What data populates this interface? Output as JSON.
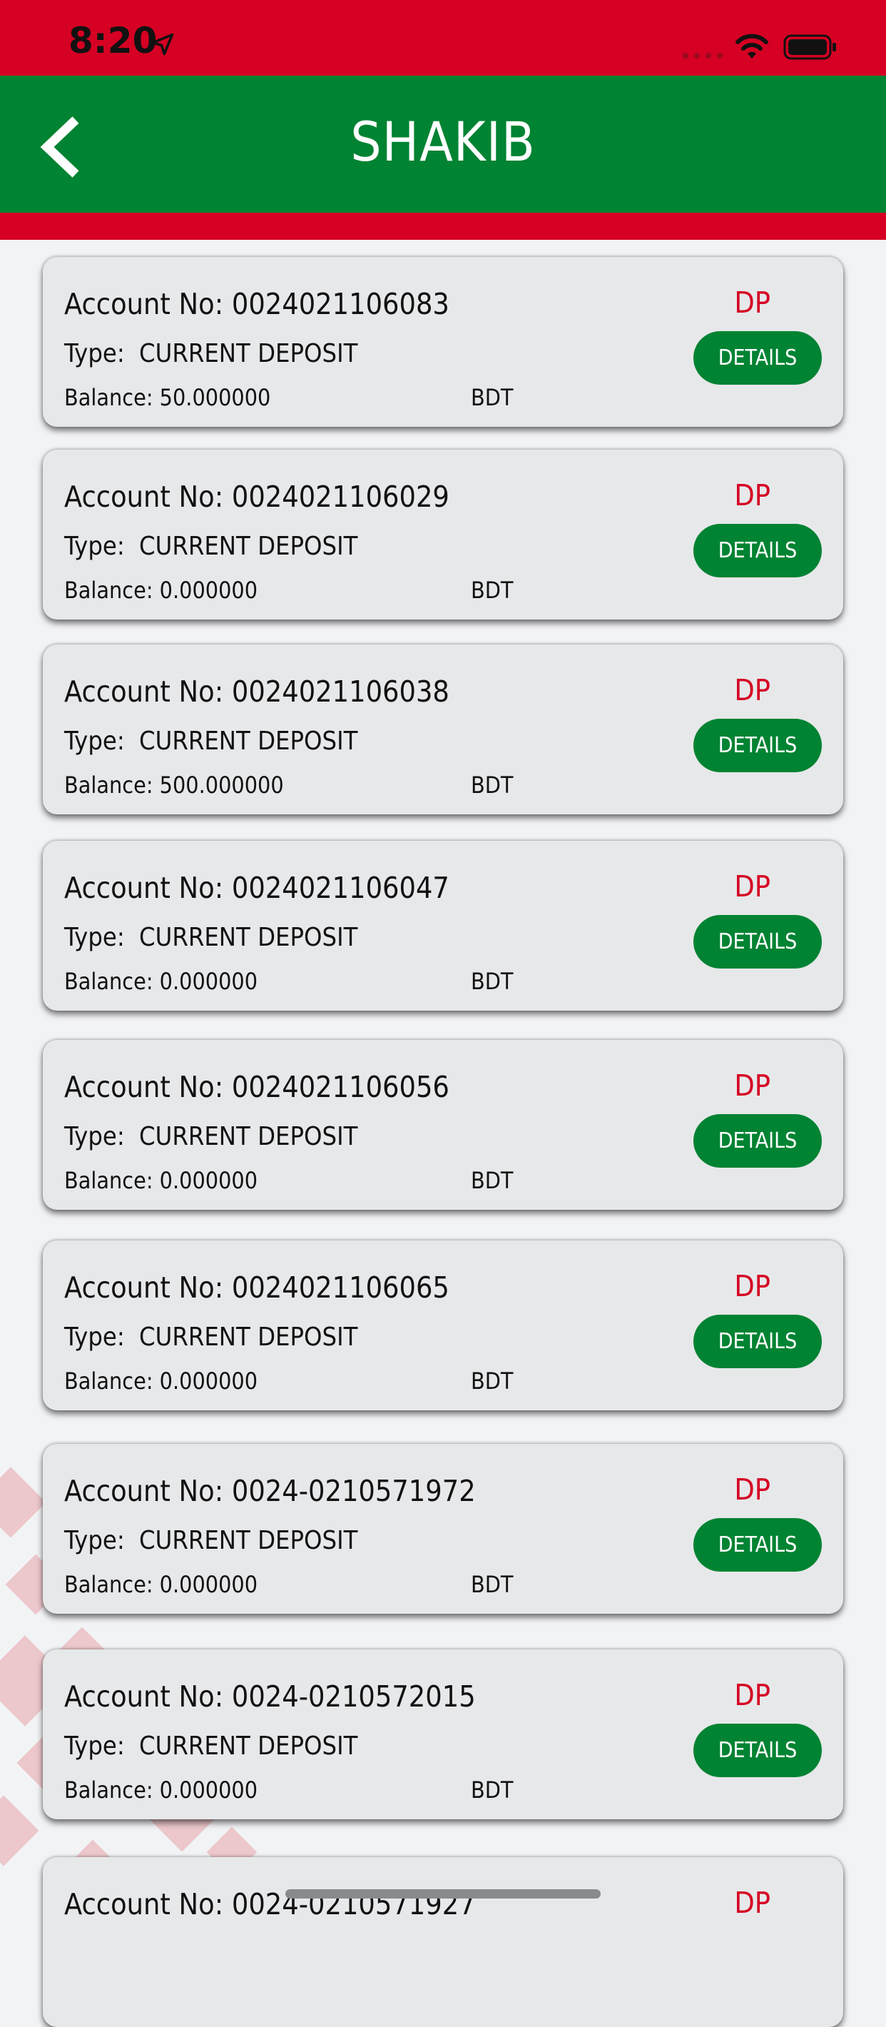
{
  "status_bar": {
    "time": "8:20"
  },
  "header": {
    "title": "SHAKIB"
  },
  "labels": {
    "account_prefix": "Account No: ",
    "type_prefix": "Type:",
    "balance_prefix": "Balance: ",
    "details": "DETAILS"
  },
  "accounts": [
    {
      "number": "0024021106083",
      "type": "CURRENT DEPOSIT",
      "balance": "50.000000",
      "currency": "BDT",
      "badge": "DP"
    },
    {
      "number": "0024021106029",
      "type": "CURRENT DEPOSIT",
      "balance": "0.000000",
      "currency": "BDT",
      "badge": "DP"
    },
    {
      "number": "0024021106038",
      "type": "CURRENT DEPOSIT",
      "balance": "500.000000",
      "currency": "BDT",
      "badge": "DP"
    },
    {
      "number": "0024021106047",
      "type": "CURRENT DEPOSIT",
      "balance": "0.000000",
      "currency": "BDT",
      "badge": "DP"
    },
    {
      "number": "0024021106056",
      "type": "CURRENT DEPOSIT",
      "balance": "0.000000",
      "currency": "BDT",
      "badge": "DP"
    },
    {
      "number": "0024021106065",
      "type": "CURRENT DEPOSIT",
      "balance": "0.000000",
      "currency": "BDT",
      "badge": "DP"
    },
    {
      "number": "0024-0210571972",
      "type": "CURRENT DEPOSIT",
      "balance": "0.000000",
      "currency": "BDT",
      "badge": "DP"
    },
    {
      "number": "0024-0210572015",
      "type": "CURRENT DEPOSIT",
      "balance": "0.000000",
      "currency": "BDT",
      "badge": "DP"
    },
    {
      "number": "0024-0210571927",
      "type": "",
      "balance": "",
      "currency": "",
      "badge": "DP"
    }
  ],
  "colors": {
    "brand_red": "#d50023",
    "brand_green": "#008332",
    "card_bg": "#e7e8ea"
  },
  "icons": [
    "back-chevron-icon",
    "location-arrow-icon",
    "wifi-icon",
    "battery-icon"
  ]
}
